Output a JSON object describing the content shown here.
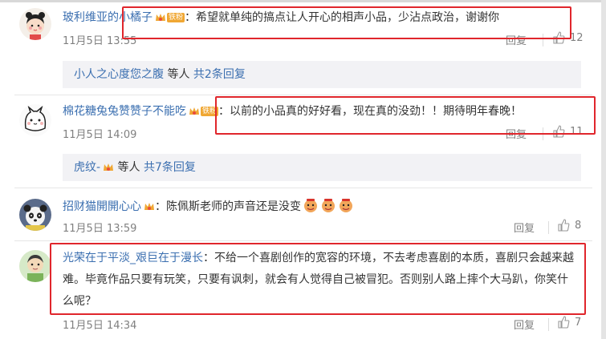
{
  "colors": {
    "link": "#3b6fb0",
    "highlight": "#e0262c",
    "badge": "#f0a733"
  },
  "comments": [
    {
      "username": "玻利维亚的小橘子",
      "badge_text": "铁粉",
      "text": "希望就单纯的搞点让人开心的相声小品，少沾点政治，谢谢你",
      "time": "11月5日 13:55",
      "reply": "回复",
      "likes": "12"
    },
    {
      "username": "棉花糖兔兔赞赞子不能吃",
      "badge_text": "铁粉",
      "text": "以前的小品真的好好看，现在真的没劲！！期待明年春晚！",
      "time": "11月5日 14:09",
      "reply": "回复",
      "likes": "11"
    },
    {
      "username": "招财猫開開心心",
      "text": "陈佩斯老师的声音还是没变",
      "time": "11月5日 13:59",
      "reply": "回复",
      "likes": "8"
    },
    {
      "username": "光荣在于平淡_艰巨在于漫长",
      "text": "不给一个喜剧创作的宽容的环境，不去考虑喜剧的本质，喜剧只会越来越难。毕竟作品只要有玩笑，只要有讽刺，就会有人觉得自己被冒犯。否则别人路上摔个大马趴，你笑什么呢？",
      "time": "11月5日 14:34",
      "reply": "回复",
      "likes": "7"
    }
  ],
  "subreplies": [
    {
      "user": "小人之心度您之腹",
      "mid": "等人",
      "more": "共2条回复"
    },
    {
      "user": "虎纹-",
      "mid": "等人",
      "more": "共7条回复"
    }
  ],
  "colon": "："
}
